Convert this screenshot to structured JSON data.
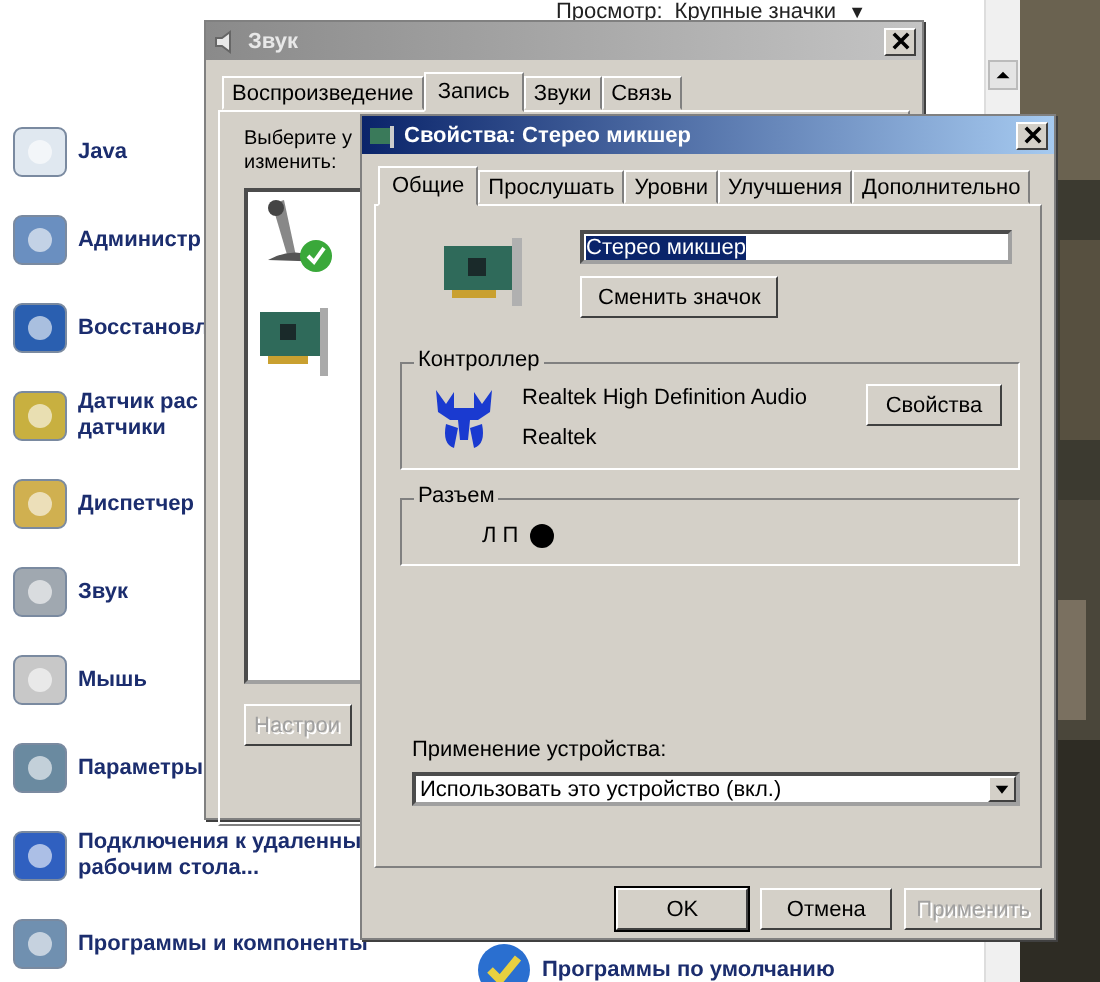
{
  "control_panel": {
    "view_label": "Просмотр:",
    "view_value": "Крупные значки",
    "view_caret": "▼",
    "items": [
      {
        "lines": [
          "Java"
        ]
      },
      {
        "lines": [
          "Администр"
        ]
      },
      {
        "lines": [
          "Восстановл"
        ]
      },
      {
        "lines": [
          "Датчик рас",
          "датчики"
        ]
      },
      {
        "lines": [
          "Диспетчер"
        ]
      },
      {
        "lines": [
          "Звук"
        ]
      },
      {
        "lines": [
          "Мышь"
        ]
      },
      {
        "lines": [
          "Параметры"
        ]
      },
      {
        "lines": [
          "Подключения к удаленны",
          "рабочим стола..."
        ]
      },
      {
        "lines": [
          "Программы и компоненты"
        ]
      }
    ],
    "column_2_items": [
      {
        "lines": [
          "Программы по умолчанию"
        ]
      }
    ]
  },
  "sound_window": {
    "title": "Звук",
    "tabs": [
      {
        "label": "Воспроизведение",
        "selected": false
      },
      {
        "label": "Запись",
        "selected": true
      },
      {
        "label": "Звуки",
        "selected": false
      },
      {
        "label": "Связь",
        "selected": false
      }
    ],
    "prompt_lines": [
      "Выберите у",
      "изменить:"
    ],
    "devices": [
      {
        "default": true
      },
      {
        "default": false
      }
    ],
    "configure_button": {
      "label": "Настрои",
      "disabled": true
    }
  },
  "properties_dialog": {
    "title": "Свойства: Стерео микшер",
    "tabs": [
      {
        "label": "Общие",
        "selected": true
      },
      {
        "label": "Прослушать",
        "selected": false
      },
      {
        "label": "Уровни",
        "selected": false
      },
      {
        "label": "Улучшения",
        "selected": false
      },
      {
        "label": "Дополнительно",
        "selected": false
      }
    ],
    "name_field": {
      "value": "Стерео микшер",
      "text_selected": true
    },
    "change_icon_button": {
      "label": "Сменить значок",
      "disabled": false
    },
    "controller": {
      "title": "Контроллер",
      "name": "Realtek High Definition Audio",
      "vendor": "Realtek",
      "button": {
        "label": "Свойства",
        "disabled": false
      }
    },
    "jack": {
      "title": "Разъем",
      "label": "Л П",
      "color": "#000000"
    },
    "usage_label": "Применение устройства:",
    "usage_select": {
      "value": "Использовать это устройство (вкл.)"
    },
    "buttons": [
      {
        "label": "OK",
        "disabled": false,
        "default": true
      },
      {
        "label": "Отмена",
        "disabled": false,
        "default": false
      },
      {
        "label": "Применить",
        "disabled": true,
        "default": false
      }
    ]
  }
}
